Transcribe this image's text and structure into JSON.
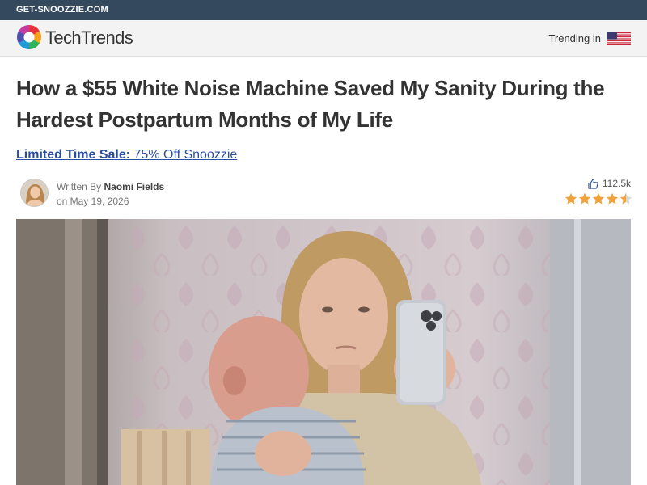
{
  "topbar": {
    "domain": "GET-SNOOZZIE.COM"
  },
  "header": {
    "brand": "TechTrends",
    "trending_label": "Trending in"
  },
  "article": {
    "headline": "How a $55 White Noise Machine Saved My Sanity During the Hardest Postpartum Months of My Life",
    "promo_bold": "Limited Time Sale:",
    "promo_rest": " 75% Off Snoozzie",
    "written_by": "Written By ",
    "author": "Naomi Fields",
    "date": "on May 19, 2026",
    "likes": "112.5k",
    "rating": 4.5
  },
  "colors": {
    "topbar": "#34495e",
    "link": "#2a4f9e",
    "star": "#f0a33a"
  }
}
